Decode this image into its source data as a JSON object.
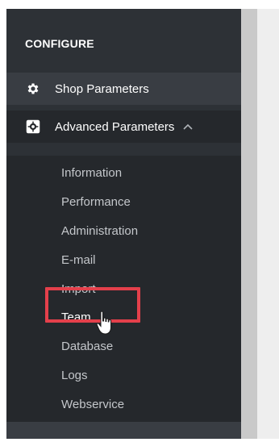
{
  "sidebar": {
    "section_title": "CONFIGURE",
    "top_items": [
      {
        "label": "Shop Parameters",
        "icon": "gear-icon"
      },
      {
        "label": "Advanced Parameters",
        "icon": "gear-icon",
        "expanded": true,
        "chevron": "chevron-up-icon"
      }
    ],
    "sub_items": [
      {
        "label": "Information"
      },
      {
        "label": "Performance"
      },
      {
        "label": "Administration"
      },
      {
        "label": "E-mail"
      },
      {
        "label": "Import"
      },
      {
        "label": "Team",
        "highlighted": true
      },
      {
        "label": "Database"
      },
      {
        "label": "Logs"
      },
      {
        "label": "Webservice"
      }
    ]
  },
  "colors": {
    "sidebar_bg": "#2d3136",
    "sidebar_active_bg": "#25282c",
    "highlight": "#e4404b"
  }
}
